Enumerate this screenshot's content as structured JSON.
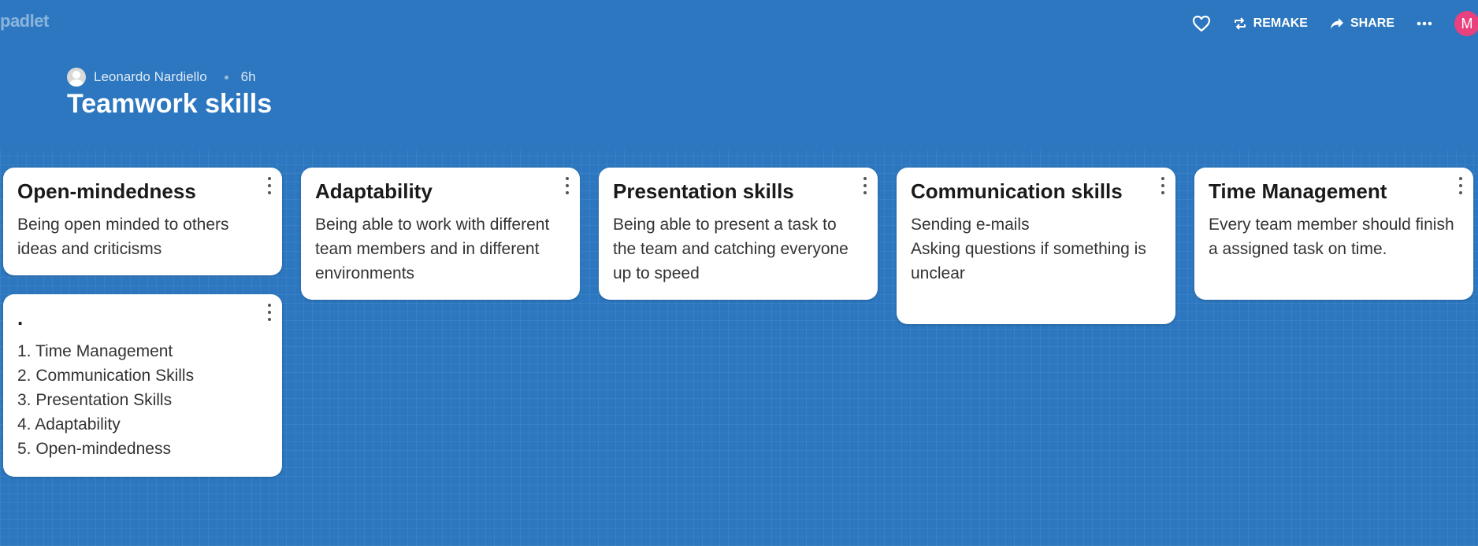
{
  "app": {
    "logo": "padlet"
  },
  "topbar": {
    "like_icon": "heart-icon",
    "remake_label": "REMAKE",
    "share_label": "SHARE",
    "more_icon": "more-horizontal-icon",
    "avatar_letter": "M"
  },
  "header": {
    "author": "Leonardo Nardiello",
    "time": "6h",
    "title": "Teamwork skills"
  },
  "cards": [
    {
      "title": "Open-mindedness",
      "body": "Being open minded to others ideas and criticisms"
    },
    {
      "title": ".",
      "body": "1. Time Management\n2. Communication Skills\n3. Presentation Skills\n4. Adaptability\n5. Open-mindedness"
    },
    {
      "title": "Adaptability",
      "body": "Being able to work with different team members and in different environments"
    },
    {
      "title": "Presentation skills",
      "body": "Being able to present a task to the team and catching everyone up to speed"
    },
    {
      "title": "Communication skills",
      "body": "Sending e-mails\nAsking questions if something is unclear"
    },
    {
      "title": "Time Management",
      "body": "Every team member should finish a assigned task on time."
    }
  ],
  "colors": {
    "background": "#2c77bf",
    "avatar": "#e8417e",
    "card": "#ffffff"
  }
}
